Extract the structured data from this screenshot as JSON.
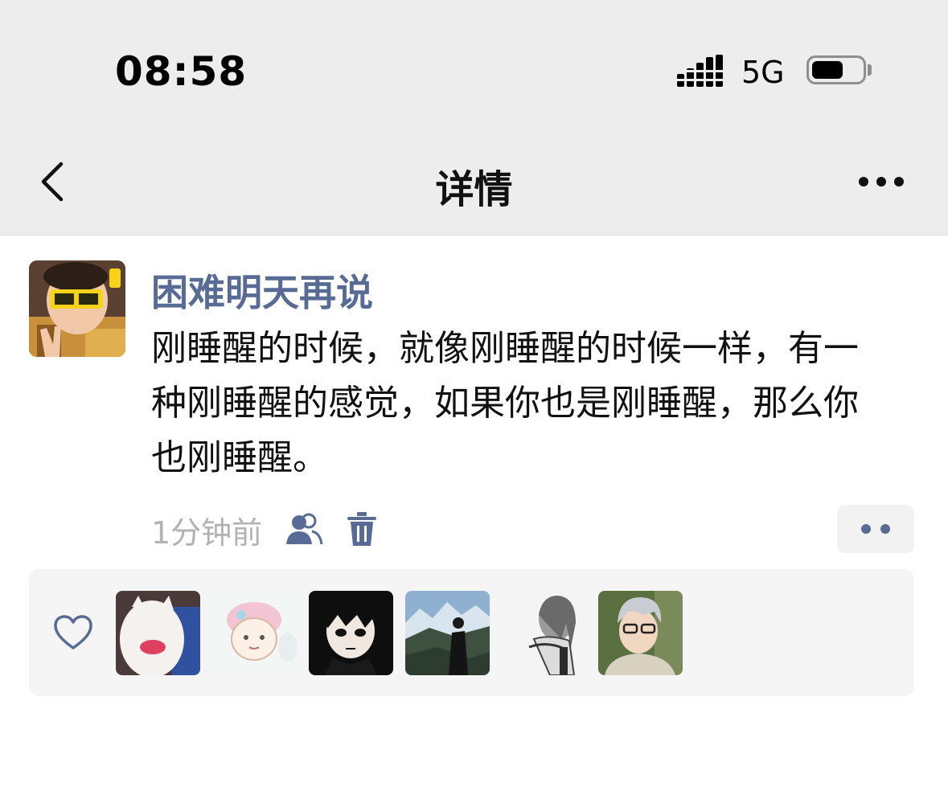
{
  "status_bar": {
    "time": "08:58",
    "network": "5G",
    "signal_icon": "signal-icon",
    "battery_icon": "battery-icon"
  },
  "nav": {
    "title": "详情",
    "back_icon": "chevron-left-icon",
    "more_icon": "more-icon"
  },
  "post": {
    "author": "困难明天再说",
    "text": "刚睡醒的时候，就像刚睡醒的时候一样，有一种刚睡醒的感觉，如果你也是刚睡醒，那么你也刚睡醒。",
    "timestamp": "1分钟前",
    "friends_icon": "friends-visibility-icon",
    "delete_icon": "trash-icon",
    "action_icon": "comment-like-menu-icon",
    "link_color": "#576b95"
  },
  "likes": {
    "heart_icon": "heart-icon",
    "avatars": [
      "liker-1",
      "liker-2",
      "liker-3",
      "liker-4",
      "liker-5",
      "liker-6"
    ]
  }
}
